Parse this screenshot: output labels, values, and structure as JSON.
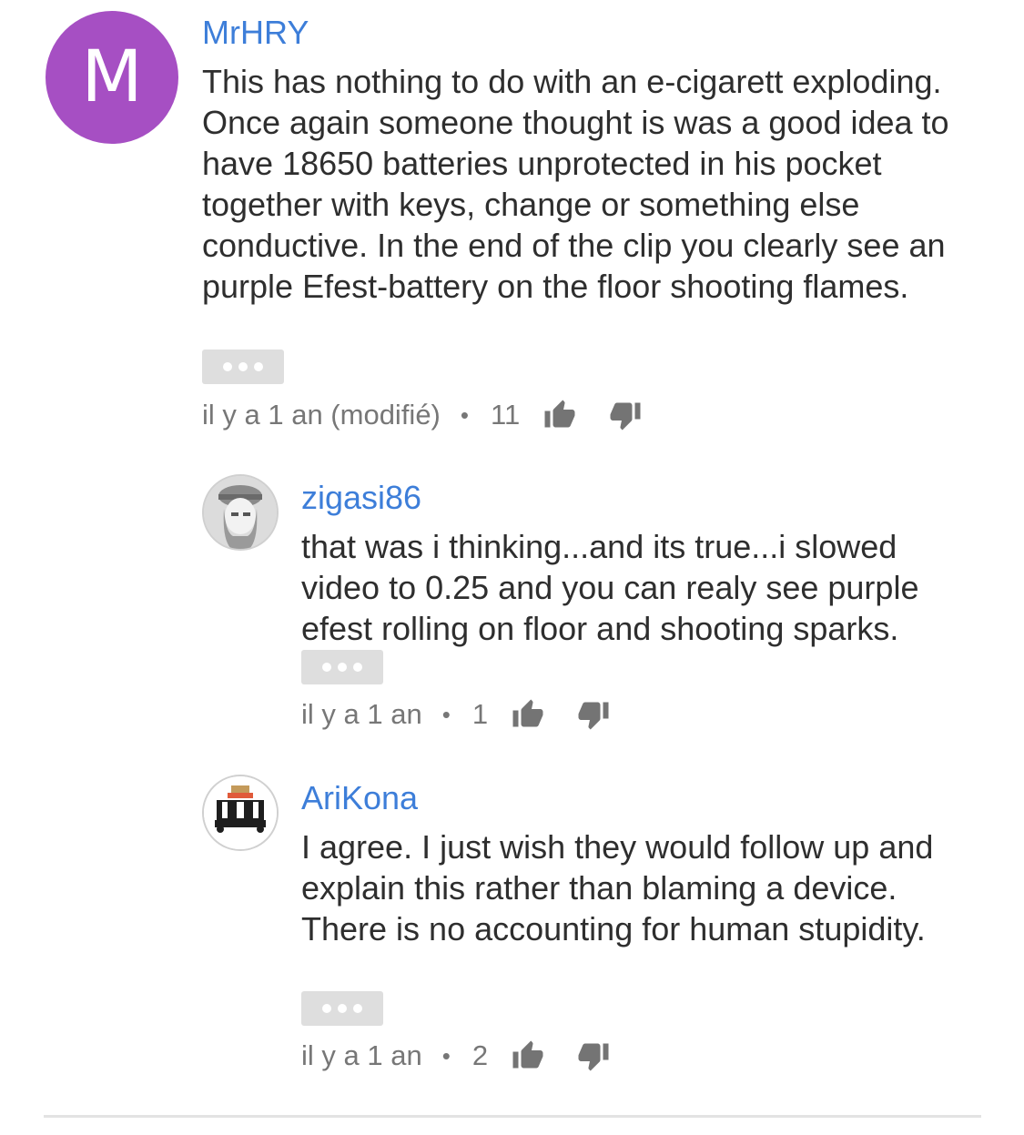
{
  "comments": [
    {
      "author": "MrHRY",
      "avatar_letter": "M",
      "avatar_color": "#a64fc3",
      "text": "This has nothing to do with an e-cigarett exploding. Once again someone thought is was a good idea to have 18650 batteries unprotected in his pocket together with keys, change or something else conductive. In the end of the clip you clearly see an purple Efest-battery on the floor shooting flames.",
      "time": "il y a 1 an (modifié)",
      "likes": "11",
      "like_icon": "thumb-up-icon",
      "dislike_icon": "thumb-down-icon"
    },
    {
      "author": "zigasi86",
      "avatar_icon": "user-photo-avatar",
      "text": "that was i thinking...and its true...i slowed video to 0.25 and you can realy see purple efest rolling on floor and shooting sparks.",
      "time": "il y a 1 an",
      "likes": "1",
      "like_icon": "thumb-up-icon",
      "dislike_icon": "thumb-down-icon"
    },
    {
      "author": "AriKona",
      "avatar_icon": "pixel-character-avatar",
      "text": "I agree. I just wish they would follow up and explain this rather than blaming a device. There is no accounting for human stupidity.",
      "time": "il y a 1 an",
      "likes": "2",
      "like_icon": "thumb-up-icon",
      "dislike_icon": "thumb-down-icon"
    }
  ],
  "meta_separator": "•",
  "colors": {
    "author": "#3d7ed9",
    "text": "#2e2e2e",
    "meta": "#777777",
    "more_button": "#dedede"
  }
}
